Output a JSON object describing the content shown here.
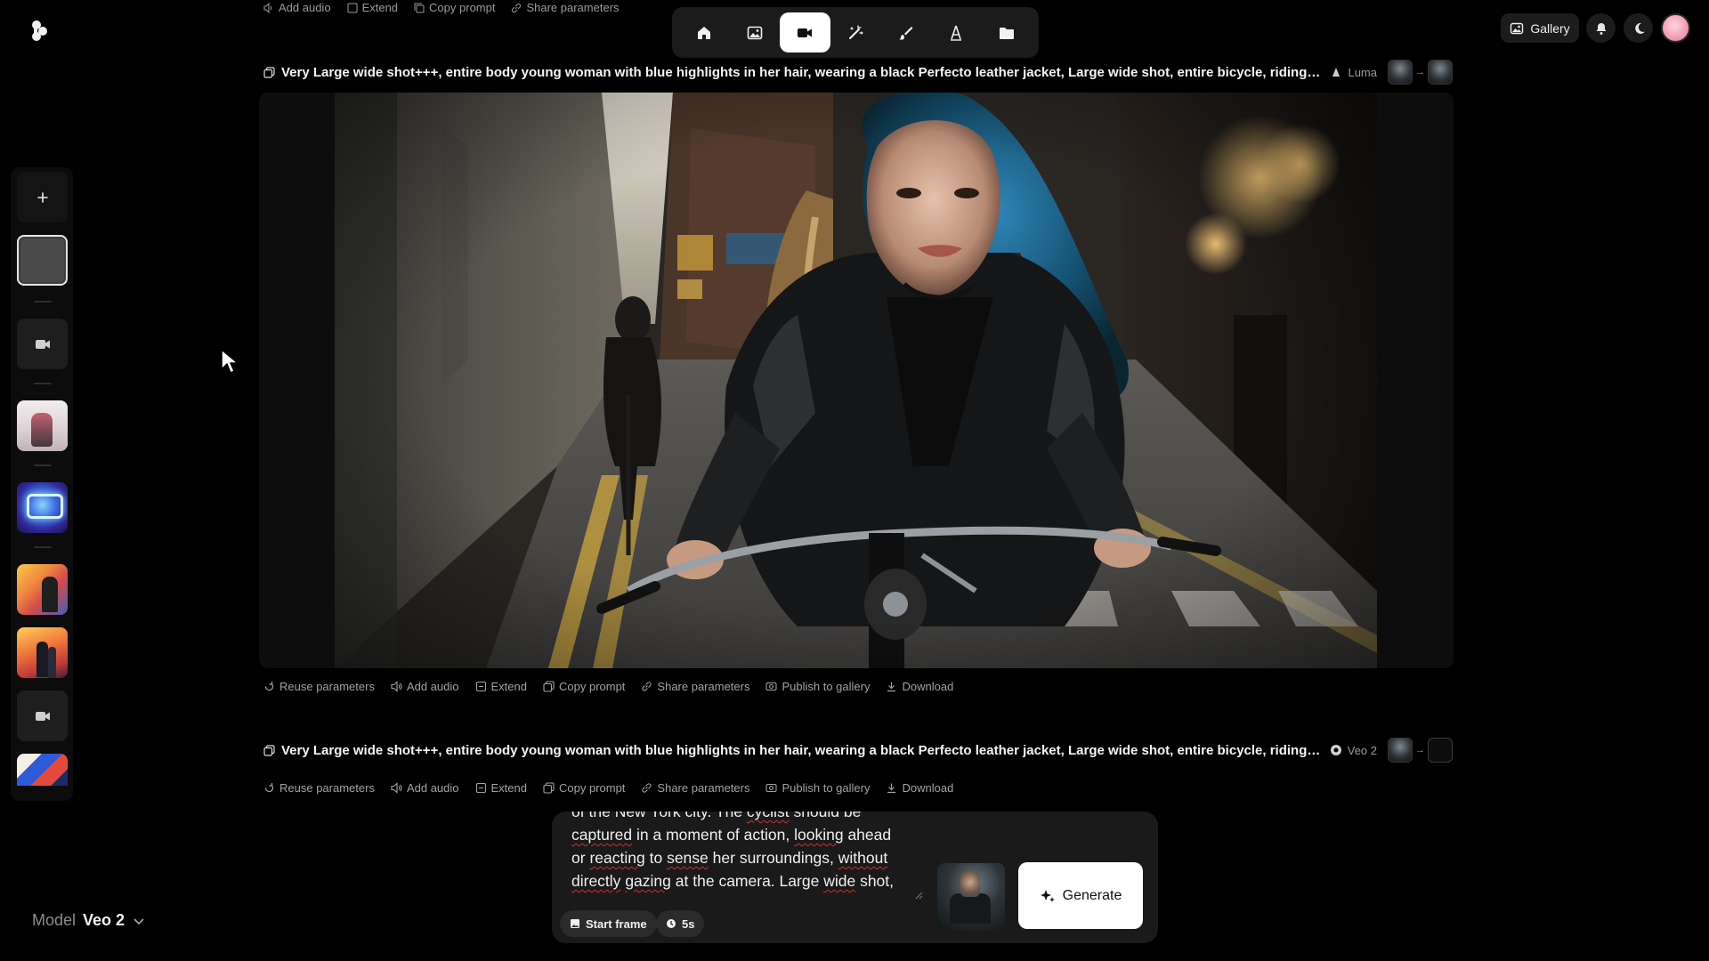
{
  "header": {
    "nav": [
      {
        "name": "home",
        "icon": "home-icon"
      },
      {
        "name": "image",
        "icon": "image-icon"
      },
      {
        "name": "video",
        "icon": "video-icon",
        "active": true
      },
      {
        "name": "edit",
        "icon": "magic-wand-icon"
      },
      {
        "name": "draw",
        "icon": "brush-icon"
      },
      {
        "name": "text",
        "icon": "text-icon"
      },
      {
        "name": "folder",
        "icon": "folder-icon"
      }
    ],
    "gallery_label": "Gallery"
  },
  "ghost_actions": [
    "Add audio",
    "Extend",
    "Copy prompt",
    "Share parameters",
    "Publish to gallery",
    "Download"
  ],
  "generations": [
    {
      "prompt": "Very Large wide shot+++, entire body young woman with blue highlights in her hair, wearing a black Perfecto leather jacket, Large wide shot, entire bicycle, riding ...",
      "engine": "Luma",
      "actions": [
        "Reuse parameters",
        "Add audio",
        "Extend",
        "Copy prompt",
        "Share parameters",
        "Publish to gallery",
        "Download"
      ]
    },
    {
      "prompt": "Very Large wide shot+++, entire body young woman with blue highlights in her hair, wearing a black Perfecto leather jacket, Large wide shot, entire bicycle, riding ...",
      "engine": "Veo 2",
      "actions": [
        "Reuse parameters",
        "Add audio",
        "Extend",
        "Copy prompt",
        "Share parameters",
        "Publish to gallery",
        "Download"
      ]
    }
  ],
  "composer": {
    "lines": [
      "of the New York city. The cyclist should be",
      "captured in a moment of action, looking ahead",
      "or reacting to sense her surroundings, without",
      "directly gazing at the camera. Large wide shot,"
    ],
    "start_frame_label": "Start frame",
    "duration_label": "5s",
    "generate_label": "Generate"
  },
  "model": {
    "label": "Model",
    "value": "Veo 2"
  },
  "colors": {
    "accent": "#ffffff",
    "background": "#000000",
    "panel": "#1a1a1a"
  }
}
